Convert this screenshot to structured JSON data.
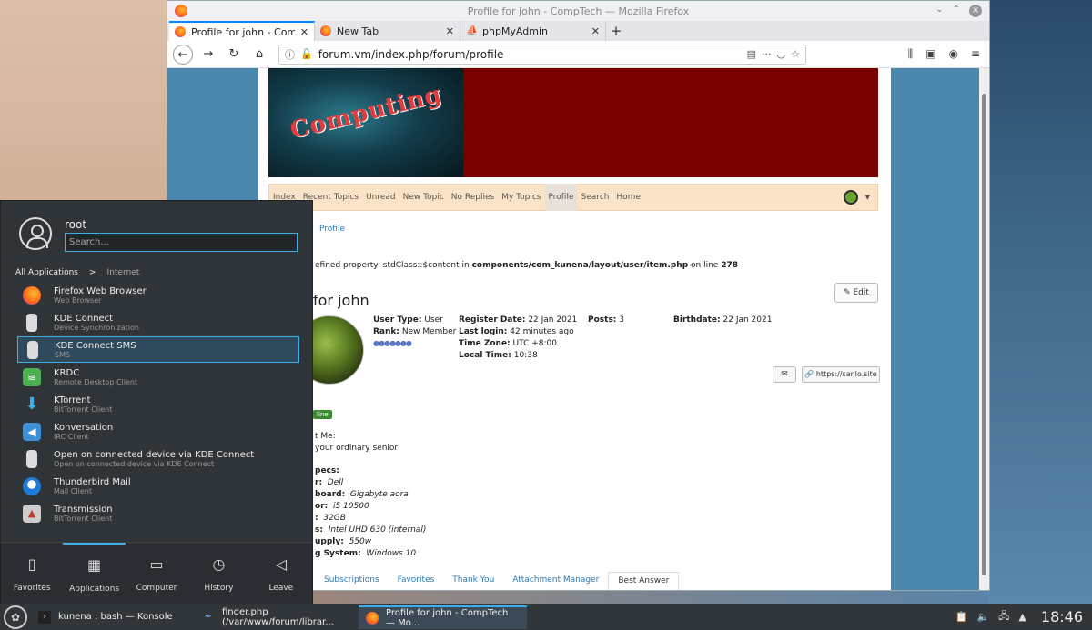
{
  "firefox": {
    "window_title": "Profile for john - CompTech — Mozilla Firefox",
    "tabs": [
      {
        "label": "Profile for john - CompTec",
        "active": true
      },
      {
        "label": "New Tab",
        "active": false
      },
      {
        "label": "phpMyAdmin",
        "active": false
      }
    ],
    "url": "forum.vm/index.php/forum/profile"
  },
  "forum": {
    "banner_text": "Computing",
    "menu": [
      "Index",
      "Recent Topics",
      "Unread",
      "New Topic",
      "No Replies",
      "My Topics",
      "Profile",
      "Search",
      "Home"
    ],
    "menu_active": "Profile",
    "breadcrumb": "Profile",
    "notice_prefix": "efined property: stdClass::$content in ",
    "notice_path": "components/com_kunena/layout/user/item.php",
    "notice_mid": " on line ",
    "notice_line": "278",
    "profile_title": "for john",
    "edit_label": "Edit",
    "online_label": "line",
    "user_type_label": "User Type:",
    "user_type": "User",
    "rank_label": "Rank:",
    "rank": "New Member",
    "register_label": "Register Date:",
    "register": "22 Jan 2021",
    "lastlogin_label": "Last login:",
    "lastlogin": "42 minutes ago",
    "tz_label": "Time Zone:",
    "tz": "UTC +8:00",
    "localtime_label": "Local Time:",
    "localtime": "10:38",
    "posts_label": "Posts:",
    "posts": "3",
    "birthdate_label": "Birthdate:",
    "birthdate": "22 Jan 2021",
    "website": "https://sanlo.site",
    "about_label": "t Me:",
    "about_text": "your ordinary senior",
    "specs_label": "pecs:",
    "specs": [
      {
        "label": "r:",
        "value": "Dell"
      },
      {
        "label": "board:",
        "value": "Gigabyte aora"
      },
      {
        "label": "or:",
        "value": "i5 10500"
      },
      {
        "label": ":",
        "value": "32GB"
      },
      {
        "label": "s:",
        "value": "Intel UHD 630 (internal)"
      },
      {
        "label": "upply:",
        "value": "550w"
      },
      {
        "label": "g System:",
        "value": "Windows 10"
      }
    ],
    "profile_tabs": [
      "Subscriptions",
      "Favorites",
      "Thank You",
      "Attachment Manager",
      "Best Answer"
    ],
    "profile_tab_active": "Best Answer"
  },
  "launcher": {
    "user": "root",
    "search_placeholder": "Search...",
    "crumb_root": "All Applications",
    "crumb_sep": ">",
    "crumb_current": "Internet",
    "apps": [
      {
        "name": "Firefox Web Browser",
        "desc": "Web Browser",
        "icon": "firefox-icon"
      },
      {
        "name": "KDE Connect",
        "desc": "Device Synchronization",
        "icon": "kdeconnect-icon"
      },
      {
        "name": "KDE Connect SMS",
        "desc": "SMS",
        "icon": "kdeconnect-sms-icon",
        "selected": true
      },
      {
        "name": "KRDC",
        "desc": "Remote Desktop Client",
        "icon": "krdc-icon"
      },
      {
        "name": "KTorrent",
        "desc": "BitTorrent Client",
        "icon": "ktorrent-icon"
      },
      {
        "name": "Konversation",
        "desc": "IRC Client",
        "icon": "konversation-icon"
      },
      {
        "name": "Open on connected device via KDE Connect",
        "desc": "Open on connected device via KDE Connect",
        "icon": "kdeconnect-open-icon"
      },
      {
        "name": "Thunderbird Mail",
        "desc": "Mail Client",
        "icon": "thunderbird-icon"
      },
      {
        "name": "Transmission",
        "desc": "BitTorrent Client",
        "icon": "transmission-icon"
      }
    ],
    "tabs": [
      {
        "label": "Favorites",
        "icon": "bookmark-icon"
      },
      {
        "label": "Applications",
        "icon": "grid-icon",
        "active": true
      },
      {
        "label": "Computer",
        "icon": "monitor-icon"
      },
      {
        "label": "History",
        "icon": "clock-icon"
      },
      {
        "label": "Leave",
        "icon": "leave-icon"
      }
    ]
  },
  "taskbar": {
    "tasks": [
      {
        "label": "kunena : bash — Konsole"
      },
      {
        "label": "finder.php (/var/www/forum/librar..."
      },
      {
        "label": "Profile for john - CompTech — Mo...",
        "active": true
      }
    ],
    "clock": "18:46"
  },
  "colors": {
    "accent": "#3daee9",
    "banner": "#7a0000",
    "link": "#2a7ab8"
  }
}
